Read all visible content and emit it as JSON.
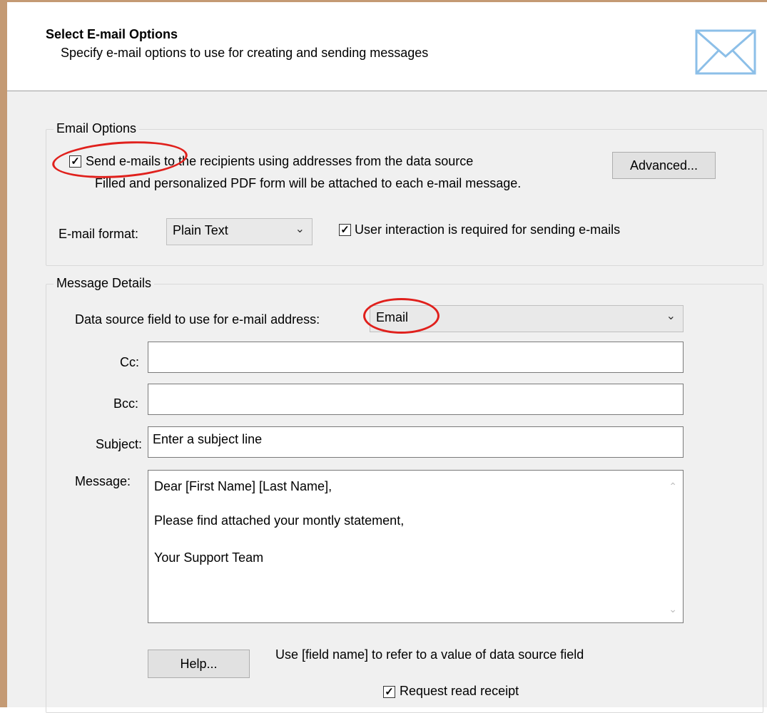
{
  "header": {
    "title": "Select E-mail Options",
    "subtitle": "Specify e-mail options to use for creating and sending messages",
    "icon": "envelope-icon"
  },
  "email_options": {
    "group_label": "Email Options",
    "send_emails_checked": true,
    "send_emails_label": "Send e-mails to the recipients using addresses from the data source",
    "send_emails_note": "Filled and personalized PDF form will be attached to each e-mail message.",
    "advanced_button": "Advanced...",
    "format_label": "E-mail format:",
    "format_value": "Plain Text",
    "user_interaction_checked": true,
    "user_interaction_label": "User interaction is required for sending e-mails"
  },
  "message_details": {
    "group_label": "Message Details",
    "address_field_label": "Data source field to use for e-mail address:",
    "address_field_value": "Email",
    "cc_label": "Cc:",
    "cc_value": "",
    "bcc_label": "Bcc:",
    "bcc_value": "",
    "subject_label": "Subject:",
    "subject_value": "Enter a subject line",
    "message_label": "Message:",
    "message_lines": [
      "Dear [First Name] [Last Name],",
      "Please find attached your montly statement,",
      "Your Support Team"
    ],
    "help_button": "Help...",
    "help_hint": "Use [field name] to refer to a value of data source field",
    "read_receipt_checked": true,
    "read_receipt_label": "Request read receipt"
  },
  "colors": {
    "annotation": "#e0201c",
    "envelope": "#8cbfe8",
    "window_border": "#c49a74"
  }
}
